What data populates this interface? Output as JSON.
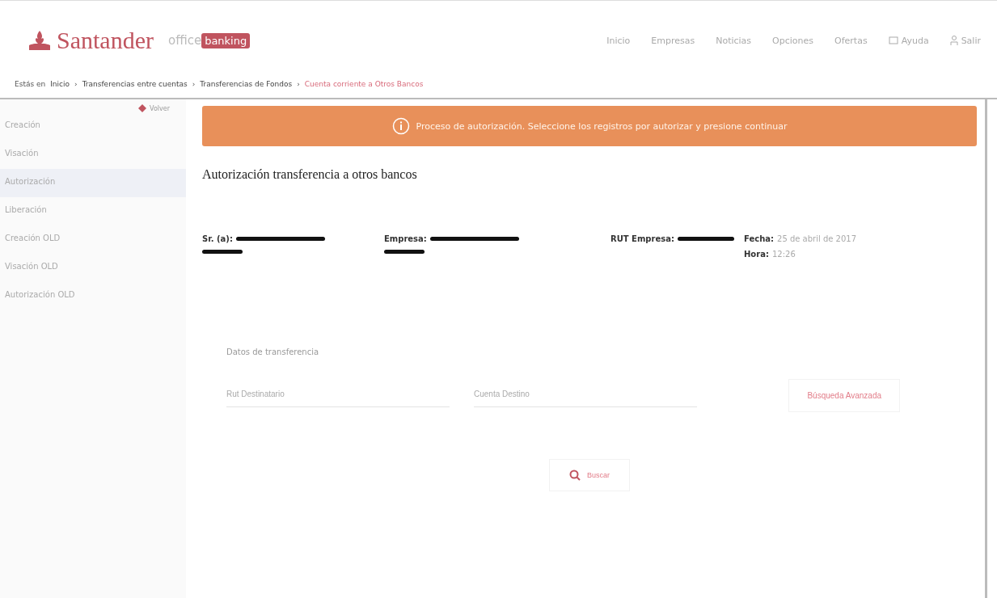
{
  "header": {
    "brand": "Santander",
    "product_prefix": "office",
    "product_badge": "banking",
    "nav": [
      "Inicio",
      "Empresas",
      "Noticias",
      "Opciones",
      "Ofertas"
    ],
    "actions": [
      {
        "kind": "help",
        "label": "Ayuda"
      },
      {
        "kind": "exit",
        "label": "Salir"
      }
    ]
  },
  "breadcrumb": {
    "prefix": "Estás en",
    "separator": "›",
    "items": [
      {
        "label": "Inicio",
        "current": false
      },
      {
        "label": "Transferencias entre cuentas",
        "current": false
      },
      {
        "label": "Transferencias de Fondos",
        "current": false
      },
      {
        "label": "Cuenta corriente a Otros Bancos",
        "current": true
      }
    ]
  },
  "sidebar": {
    "back": "Volver",
    "items": [
      {
        "label": "Creación",
        "selected": false
      },
      {
        "label": "Visación",
        "selected": false
      },
      {
        "label": "Autorización",
        "selected": true
      },
      {
        "label": "Liberación",
        "selected": false
      },
      {
        "label": "Creación OLD",
        "selected": false
      },
      {
        "label": "Visación OLD",
        "selected": false
      },
      {
        "label": "Autorización OLD",
        "selected": false
      }
    ]
  },
  "alert": {
    "text": "Proceso de autorización. Seleccione los registros por autorizar y presione continuar"
  },
  "title": "Autorización transferencia a otros bancos",
  "info": [
    {
      "label": "Sr. (a):",
      "redacted": true
    },
    {
      "label": "Empresa:",
      "redacted": true
    },
    {
      "label": "RUT Empresa:",
      "redacted": true
    },
    {
      "label": "Fecha:",
      "value": "25 de abril de 2017",
      "redacted": false
    },
    {
      "label": "Hora:",
      "value": "12:26",
      "redacted": false
    }
  ],
  "form": {
    "section": "Datos de transferencia",
    "fields": [
      {
        "placeholder": "Rut Destinatario"
      },
      {
        "placeholder": "Cuenta Destino"
      }
    ],
    "advanced": "Búsqueda Avanzada",
    "search": "Buscar"
  }
}
